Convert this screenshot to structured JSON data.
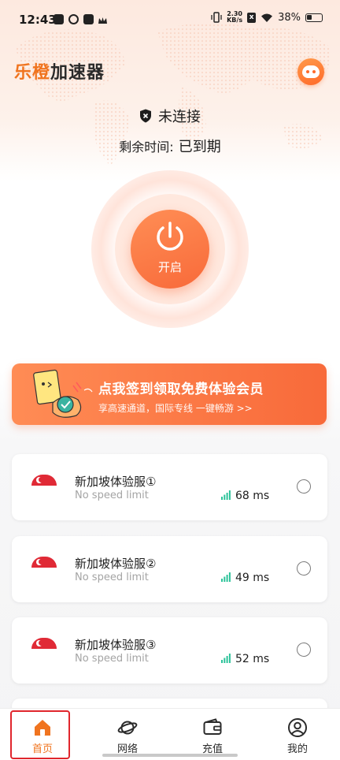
{
  "status_bar": {
    "time": "12:43",
    "net_speed_value": "2.30",
    "net_speed_unit": "KB/s",
    "battery": "38%"
  },
  "header": {
    "logo_part1": "乐橙",
    "logo_part2": "加速器"
  },
  "connection": {
    "status": "未连接",
    "remaining_label": "剩余时间:",
    "remaining_value": "已到期"
  },
  "power_button": {
    "label": "开启"
  },
  "banner": {
    "title": "点我签到领取免费体验会员",
    "subtitle": "享高速通道，国际专线 一键畅游 >>"
  },
  "servers": [
    {
      "name": "新加坡体验服①",
      "desc": "No speed limit",
      "latency": "68 ms"
    },
    {
      "name": "新加坡体验服②",
      "desc": "No speed limit",
      "latency": "49 ms"
    },
    {
      "name": "新加坡体验服③",
      "desc": "No speed limit",
      "latency": "52 ms"
    }
  ],
  "nav": [
    {
      "label": "首页"
    },
    {
      "label": "网络"
    },
    {
      "label": "充值"
    },
    {
      "label": "我的"
    }
  ],
  "colors": {
    "accent": "#f0741f",
    "power_gradient_start": "#ff8e55",
    "power_gradient_end": "#f86a3a",
    "signal_green": "#2cc39a",
    "highlight_red": "#e0262d"
  }
}
